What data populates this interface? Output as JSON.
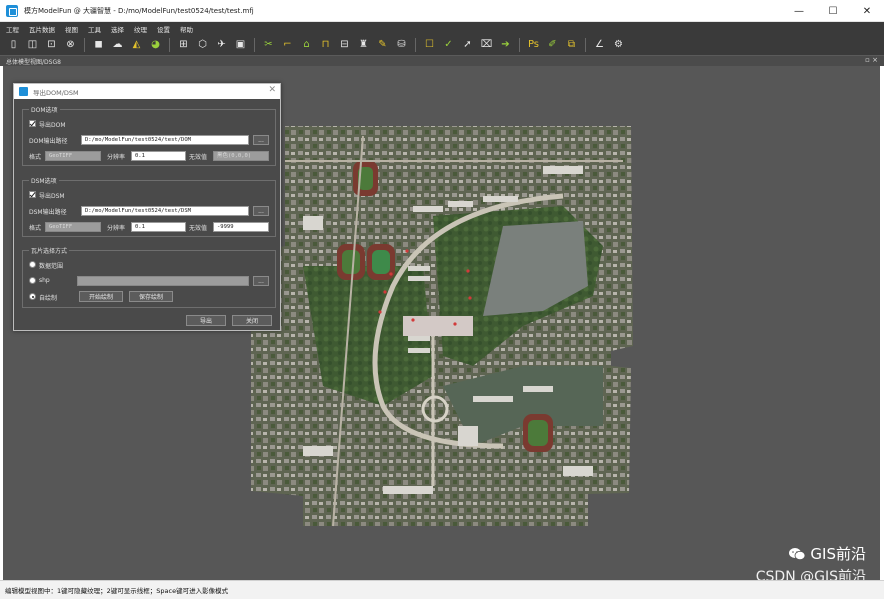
{
  "window": {
    "title": "模方ModelFun @ 大疆智慧 - D:/mo/ModelFun/test0524/test/test.mfj",
    "controls": [
      "—",
      "☐",
      "✕"
    ]
  },
  "menu": [
    "工程",
    "瓦片数据",
    "视图",
    "工具",
    "选择",
    "纹理",
    "设置",
    "帮助"
  ],
  "view": {
    "title": "总体模型视图/DSG8",
    "controls": "▫ ×"
  },
  "dialog": {
    "title": "导出DOM/DSM",
    "close": "✕",
    "dom": {
      "group_label": "DOM选项",
      "export_label": "导出DOM",
      "export_checked": true,
      "path_label": "DOM输出路径",
      "path_value": "D:/mo/ModelFun/test0524/test/DOM",
      "browse": "...",
      "format_label": "格式",
      "format_value": "GeoTIFF",
      "resolution_label": "分辨率",
      "resolution_value": "0.1",
      "nodata_label": "无效值",
      "nodata_value": "黑色(0,0,0)"
    },
    "dsm": {
      "group_label": "DSM选项",
      "export_label": "导出DSM",
      "export_checked": true,
      "path_label": "DSM输出路径",
      "path_value": "D:/mo/ModelFun/test0524/test/DSM",
      "browse": "...",
      "format_label": "格式",
      "format_value": "GeoTIFF",
      "resolution_label": "分辨率",
      "resolution_value": "0.1",
      "nodata_label": "无效值",
      "nodata_value": "-9999"
    },
    "tiles": {
      "group_label": "瓦片选择方式",
      "opt_range": "数据范围",
      "opt_shp": "shp",
      "opt_draw": "自绘制",
      "selected": "自绘制",
      "browse": "...",
      "start_draw": "开始绘制",
      "save_draw": "保存绘制"
    },
    "export_btn": "导出",
    "close_btn": "关闭"
  },
  "status": "编辑模型视图中：1键可隐藏纹理；2键可显示线框；Space键可进入影像模式",
  "watermark": {
    "line1": "GIS前沿",
    "line2": "CSDN @GIS前沿"
  },
  "colors": {
    "menubar": "#3a3a3a",
    "canvas": "#575757",
    "accent": "#1e8fd8"
  }
}
